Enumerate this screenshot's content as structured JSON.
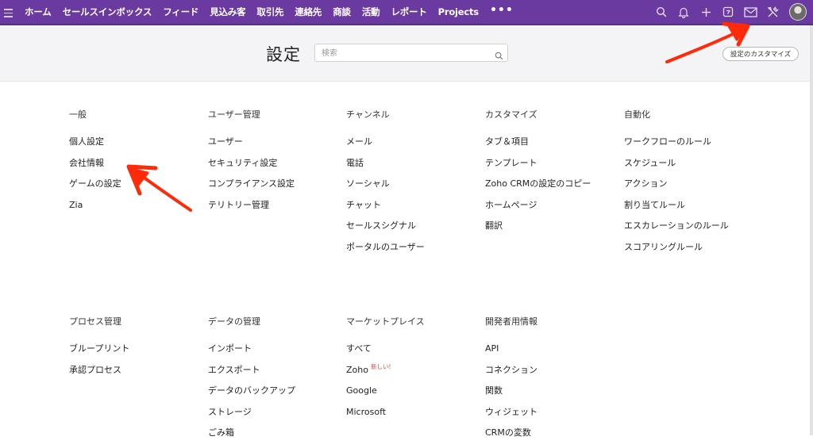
{
  "nav": {
    "items": [
      {
        "label": "ホーム",
        "key": "home"
      },
      {
        "label": "セールスインボックス",
        "key": "salesinbox"
      },
      {
        "label": "フィード",
        "key": "feeds"
      },
      {
        "label": "見込み客",
        "key": "leads"
      },
      {
        "label": "取引先",
        "key": "accounts"
      },
      {
        "label": "連絡先",
        "key": "contacts"
      },
      {
        "label": "商談",
        "key": "deals"
      },
      {
        "label": "活動",
        "key": "activities"
      },
      {
        "label": "レポート",
        "key": "reports"
      },
      {
        "label": "Projects",
        "key": "projects"
      }
    ],
    "more": "•••",
    "accent": "#6b3aa0"
  },
  "header": {
    "title": "設定",
    "search_placeholder": "検索",
    "customize_label": "設定のカスタマイズ"
  },
  "sections_top": [
    {
      "title": "一般",
      "items": [
        "個人設定",
        "会社情報",
        "ゲームの設定",
        "Zia"
      ]
    },
    {
      "title": "ユーザー管理",
      "items": [
        "ユーザー",
        "セキュリティ設定",
        "コンプライアンス設定",
        "テリトリー管理"
      ]
    },
    {
      "title": "チャンネル",
      "items": [
        "メール",
        "電話",
        "ソーシャル",
        "チャット",
        "セールスシグナル",
        "ポータルのユーザー"
      ]
    },
    {
      "title": "カスタマイズ",
      "items": [
        "タブ＆項目",
        "テンプレート",
        "Zoho CRMの設定のコピー",
        "ホームページ",
        "翻訳"
      ]
    },
    {
      "title": "自動化",
      "items": [
        "ワークフローのルール",
        "スケジュール",
        "アクション",
        "割り当てルール",
        "エスカレーションのルール",
        "スコアリングルール"
      ]
    }
  ],
  "sections_bottom": [
    {
      "title": "プロセス管理",
      "items": [
        "ブループリント",
        "承認プロセス"
      ]
    },
    {
      "title": "データの管理",
      "items": [
        "インポート",
        "エクスポート",
        "データのバックアップ",
        "ストレージ",
        "ごみ箱"
      ]
    },
    {
      "title": "マーケットプレイス",
      "items": [
        "すべて",
        "Zoho",
        "Google",
        "Microsoft"
      ],
      "new_badge": "新しい!"
    },
    {
      "title": "開発者用情報",
      "items": [
        "API",
        "コネクション",
        "関数",
        "ウィジェット",
        "CRMの変数"
      ]
    }
  ],
  "annotation_color": "#ff2a0a"
}
